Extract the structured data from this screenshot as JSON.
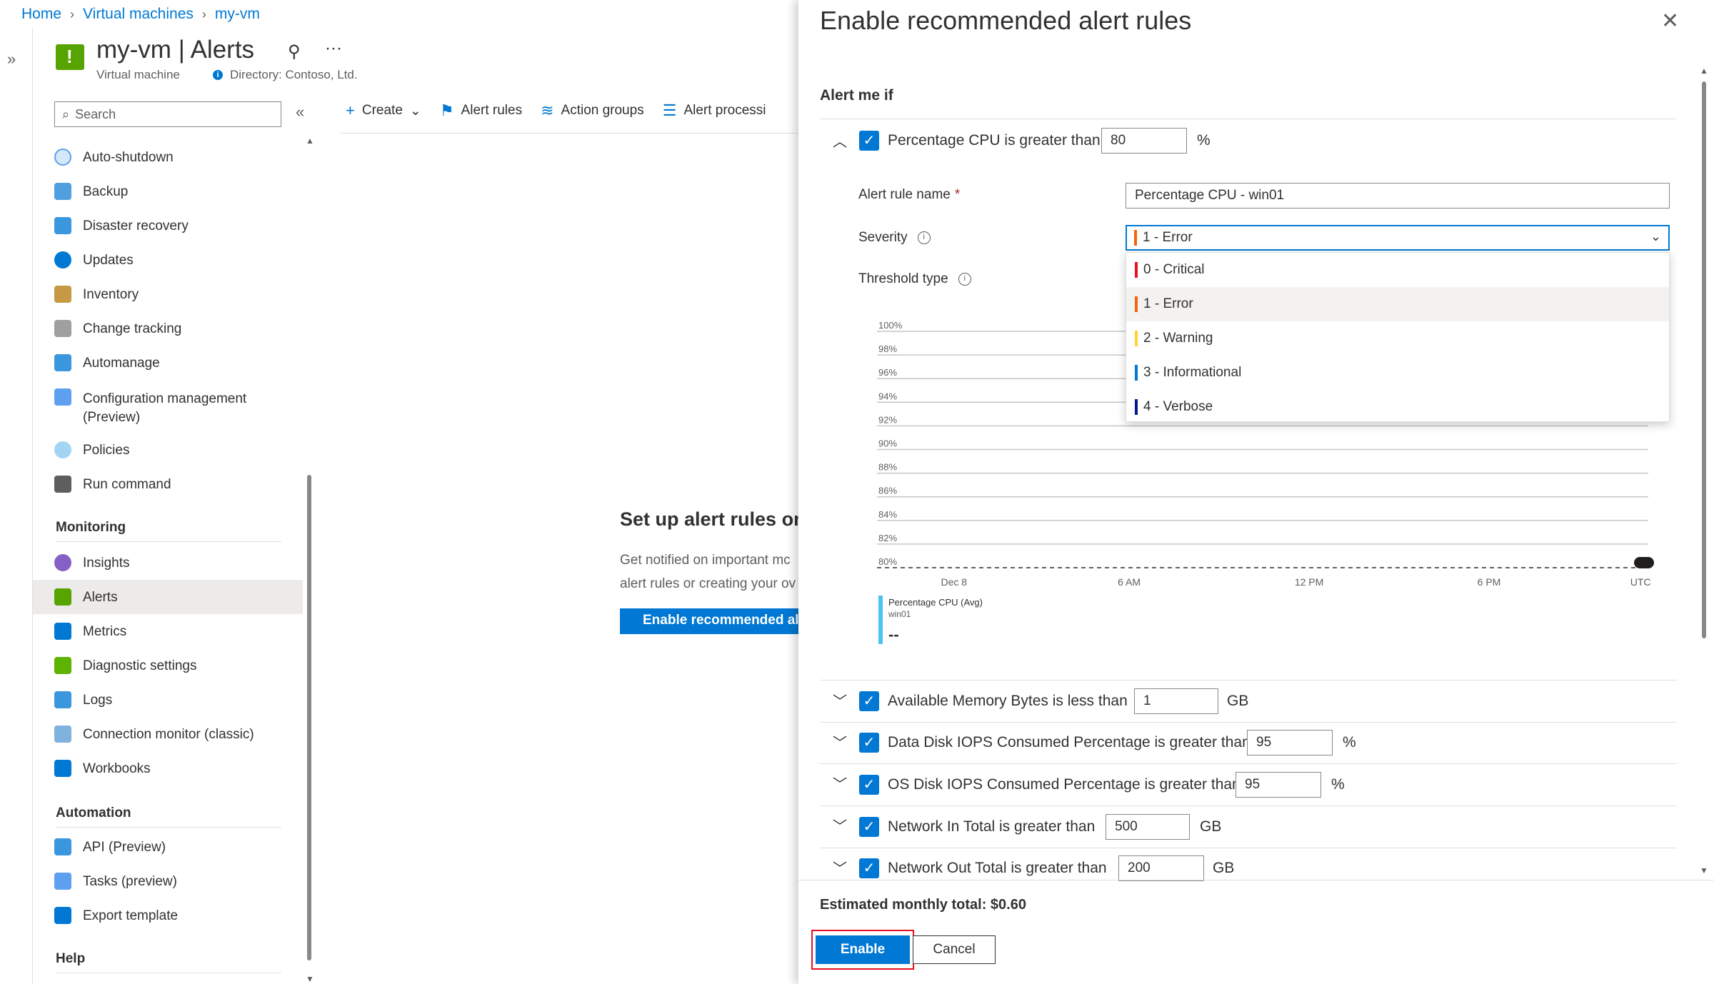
{
  "breadcrumb": {
    "items": [
      "Home",
      "Virtual machines",
      "my-vm"
    ]
  },
  "resource": {
    "title": "my-vm | Alerts",
    "type": "Virtual machine",
    "directory": "Directory: Contoso, Ltd."
  },
  "search": {
    "placeholder": "Search"
  },
  "toolbar": {
    "create": "Create",
    "alert_rules": "Alert rules",
    "action_groups": "Action groups",
    "alert_processing": "Alert processi"
  },
  "nav": {
    "items_top": [
      "Auto-shutdown",
      "Backup",
      "Disaster recovery",
      "Updates",
      "Inventory",
      "Change tracking",
      "Automanage"
    ],
    "config_mgmt_line1": "Configuration management",
    "config_mgmt_line2": "(Preview)",
    "items_mid": [
      "Policies",
      "Run command"
    ],
    "monitoring_header": "Monitoring",
    "monitoring_items": [
      "Insights",
      "Alerts",
      "Metrics",
      "Diagnostic settings",
      "Logs",
      "Connection monitor (classic)",
      "Workbooks"
    ],
    "automation_header": "Automation",
    "automation_items": [
      "API (Preview)",
      "Tasks (preview)",
      "Export template"
    ],
    "help_header": "Help"
  },
  "empty_state": {
    "title": "Set up alert rules on",
    "line1": "Get notified on important mc",
    "line2": "alert rules or creating your ov",
    "button": "Enable recommended ale"
  },
  "panel": {
    "title": "Enable recommended alert rules",
    "alert_me_if": "Alert me if",
    "cpu": {
      "condition": "Percentage CPU is greater than",
      "value": "80",
      "unit": "%"
    },
    "rule_name_label": "Alert rule name",
    "rule_name_required": "*",
    "rule_name_value": "Percentage CPU - win01",
    "severity_label": "Severity",
    "severity_selected": "1 - Error",
    "severity_options": [
      {
        "label": "0 - Critical",
        "color": "#e81123"
      },
      {
        "label": "1 - Error",
        "color": "#f7630c"
      },
      {
        "label": "2 - Warning",
        "color": "#ffd335"
      },
      {
        "label": "3 - Informational",
        "color": "#0078d4"
      },
      {
        "label": "4 - Verbose",
        "color": "#001a8c"
      }
    ],
    "threshold_label": "Threshold type",
    "rules": [
      {
        "condition": "Available Memory Bytes is less than",
        "value": "1",
        "unit": "GB"
      },
      {
        "condition": "Data Disk IOPS Consumed Percentage is greater than",
        "value": "95",
        "unit": "%"
      },
      {
        "condition": "OS Disk IOPS Consumed Percentage is greater than",
        "value": "95",
        "unit": "%"
      },
      {
        "condition": "Network In Total is greater than",
        "value": "500",
        "unit": "GB"
      },
      {
        "condition": "Network Out Total is greater than",
        "value": "200",
        "unit": "GB"
      }
    ],
    "estimate": "Estimated monthly total: $0.60",
    "enable": "Enable",
    "cancel": "Cancel"
  },
  "chart": {
    "y_ticks": [
      "100%",
      "98%",
      "96%",
      "94%",
      "92%",
      "90%",
      "88%",
      "86%",
      "84%",
      "82%",
      "80%"
    ],
    "x_ticks": [
      "Dec 8",
      "6 AM",
      "12 PM",
      "6 PM",
      "UTC"
    ],
    "legend_series": "Percentage CPU (Avg)",
    "legend_resource": "win01",
    "legend_value": "--",
    "series_color": "#4cc2f1"
  },
  "chart_data": {
    "type": "line",
    "ylim": [
      80,
      100
    ],
    "y_ticks": [
      "100%",
      "98%",
      "96%",
      "94%",
      "92%",
      "90%",
      "88%",
      "86%",
      "84%",
      "82%",
      "80%"
    ],
    "x_ticks": [
      "Dec 8",
      "6 AM",
      "12 PM",
      "6 PM",
      "UTC"
    ],
    "series": [
      {
        "name": "Percentage CPU (Avg)",
        "values": []
      }
    ],
    "threshold": 80
  }
}
